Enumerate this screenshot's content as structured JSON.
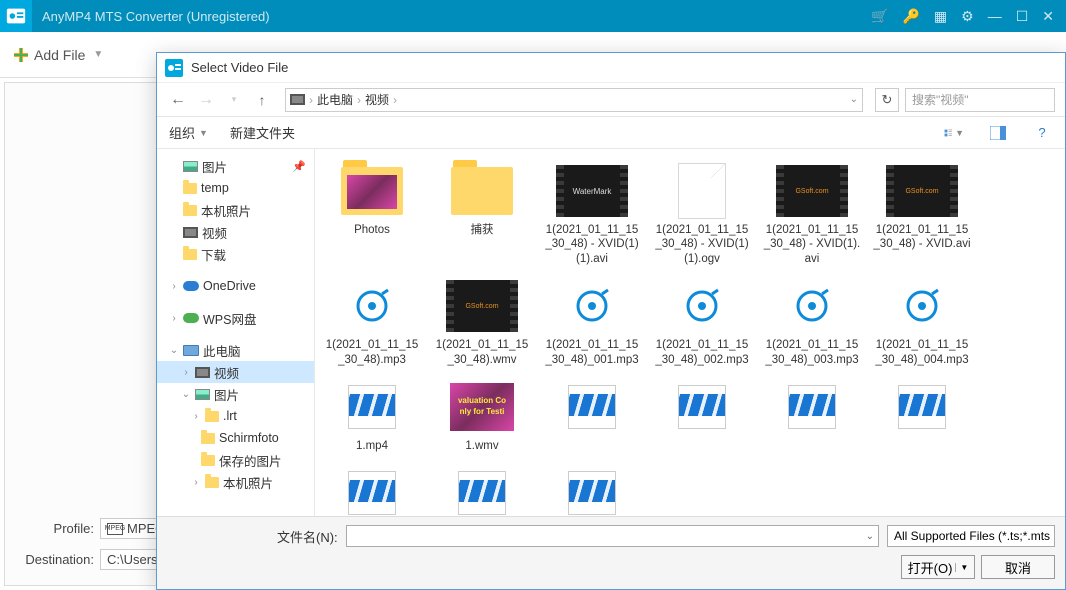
{
  "main": {
    "title": "AnyMP4 MTS Converter (Unregistered)",
    "add_file": "Add File",
    "profile_label": "Profile:",
    "profile_value": "MPEG",
    "dest_label": "Destination:",
    "dest_value": "C:\\Users\\"
  },
  "dialog": {
    "title": "Select Video File",
    "crumb1": "此电脑",
    "crumb2": "视频",
    "search_placeholder": "搜索\"视频\"",
    "organize": "组织",
    "new_folder": "新建文件夹",
    "filename_label": "文件名(N):",
    "filter": "All Supported Files (*.ts;*.mts",
    "open_btn": "打开(O)",
    "cancel_btn": "取消"
  },
  "tree": {
    "pictures": "图片",
    "temp": "temp",
    "local_photos": "本机照片",
    "videos": "视频",
    "downloads": "下载",
    "onedrive": "OneDrive",
    "wps": "WPS网盘",
    "this_pc": "此电脑",
    "videos2": "视频",
    "pictures2": "图片",
    "lrt": ".lrt",
    "schirmfoto": "Schirmfoto",
    "saved_pics": "保存的图片",
    "local_photos2": "本机照片"
  },
  "files": [
    {
      "name": "Photos",
      "type": "folder-img"
    },
    {
      "name": "捕获",
      "type": "folder"
    },
    {
      "name": "1(2021_01_11_15_30_48) - XVID(1)(1).avi",
      "type": "video-wm"
    },
    {
      "name": "1(2021_01_11_15_30_48) - XVID(1)(1).ogv",
      "type": "page"
    },
    {
      "name": "1(2021_01_11_15_30_48) - XVID(1).avi",
      "type": "video"
    },
    {
      "name": "1(2021_01_11_15_30_48) - XVID.avi",
      "type": "video"
    },
    {
      "name": "1(2021_01_11_15_30_48).mp3",
      "type": "audio"
    },
    {
      "name": "1(2021_01_11_15_30_48).wmv",
      "type": "video"
    },
    {
      "name": "1(2021_01_11_15_30_48)_001.mp3",
      "type": "audio"
    },
    {
      "name": "1(2021_01_11_15_30_48)_002.mp3",
      "type": "audio"
    },
    {
      "name": "1(2021_01_11_15_30_48)_003.mp3",
      "type": "audio"
    },
    {
      "name": "1(2021_01_11_15_30_48)_004.mp3",
      "type": "audio"
    },
    {
      "name": "1.mp4",
      "type": "mp4"
    },
    {
      "name": "1.wmv",
      "type": "wmv"
    },
    {
      "name": "",
      "type": "mp4"
    },
    {
      "name": "",
      "type": "mp4"
    },
    {
      "name": "",
      "type": "mp4"
    },
    {
      "name": "",
      "type": "mp4"
    },
    {
      "name": "",
      "type": "mp4"
    },
    {
      "name": "",
      "type": "mp4"
    },
    {
      "name": "",
      "type": "mp4"
    }
  ]
}
